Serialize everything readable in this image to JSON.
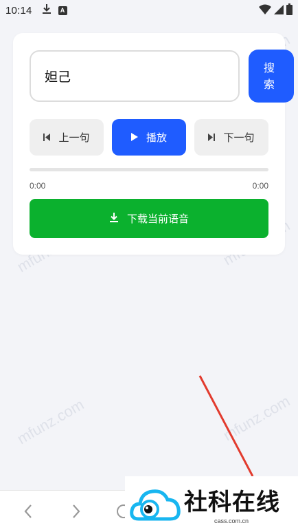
{
  "status_bar": {
    "time": "10:14",
    "icons": [
      "download-icon",
      "a-letter-icon",
      "wifi-icon",
      "signal-icon",
      "battery-icon"
    ],
    "a_letter": "A"
  },
  "search": {
    "value": "妲己",
    "button_label": "搜\n索"
  },
  "controls": {
    "prev_label": "上一句",
    "play_label": "播放",
    "next_label": "下一句"
  },
  "player": {
    "current_time": "0:00",
    "total_time": "0:00",
    "progress": 0
  },
  "download": {
    "label": "下载当前语音"
  },
  "watermark": {
    "text": "mfunz.com"
  },
  "overlay_logo": {
    "title": "社科在线",
    "subtitle": "cass.com.cn"
  },
  "colors": {
    "accent": "#1f5cff",
    "download": "#0bb12e",
    "background": "#f3f4f8",
    "arrow": "#e23b2e"
  }
}
